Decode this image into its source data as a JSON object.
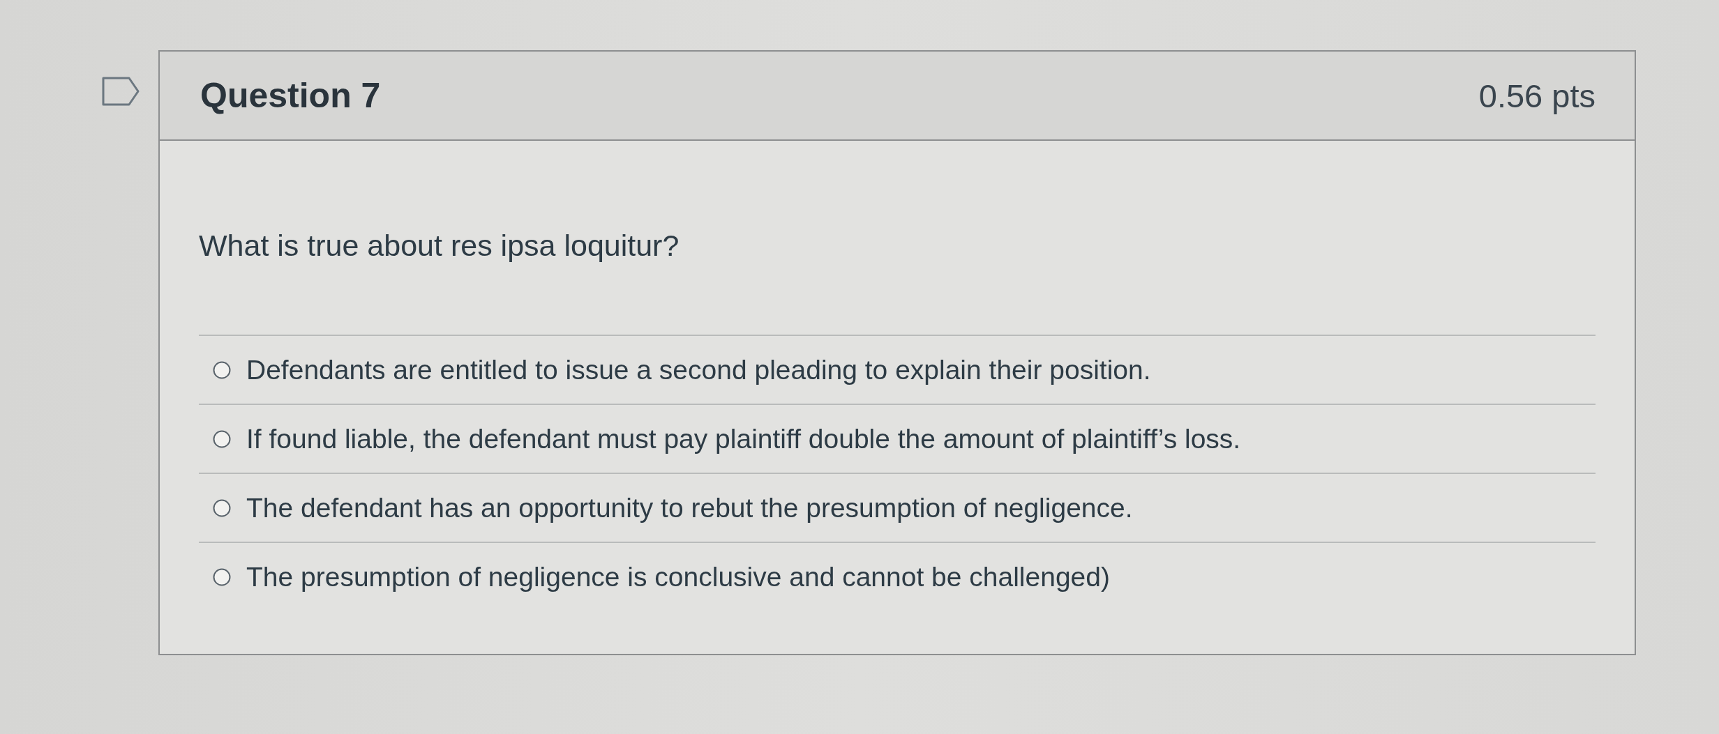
{
  "question": {
    "flagged": false,
    "title": "Question 7",
    "points": "0.56 pts",
    "prompt": "What is true about res ipsa loquitur?",
    "answers": [
      {
        "text": "Defendants are entitled to issue a second pleading to explain their position.",
        "selected": false
      },
      {
        "text": "If found liable, the defendant must pay plaintiff double the amount of plaintiff’s loss.",
        "selected": false
      },
      {
        "text": "The defendant has an opportunity to rebut the presumption of negligence.",
        "selected": false
      },
      {
        "text": "The presumption of negligence is conclusive and cannot be challenged)",
        "selected": false
      }
    ]
  }
}
